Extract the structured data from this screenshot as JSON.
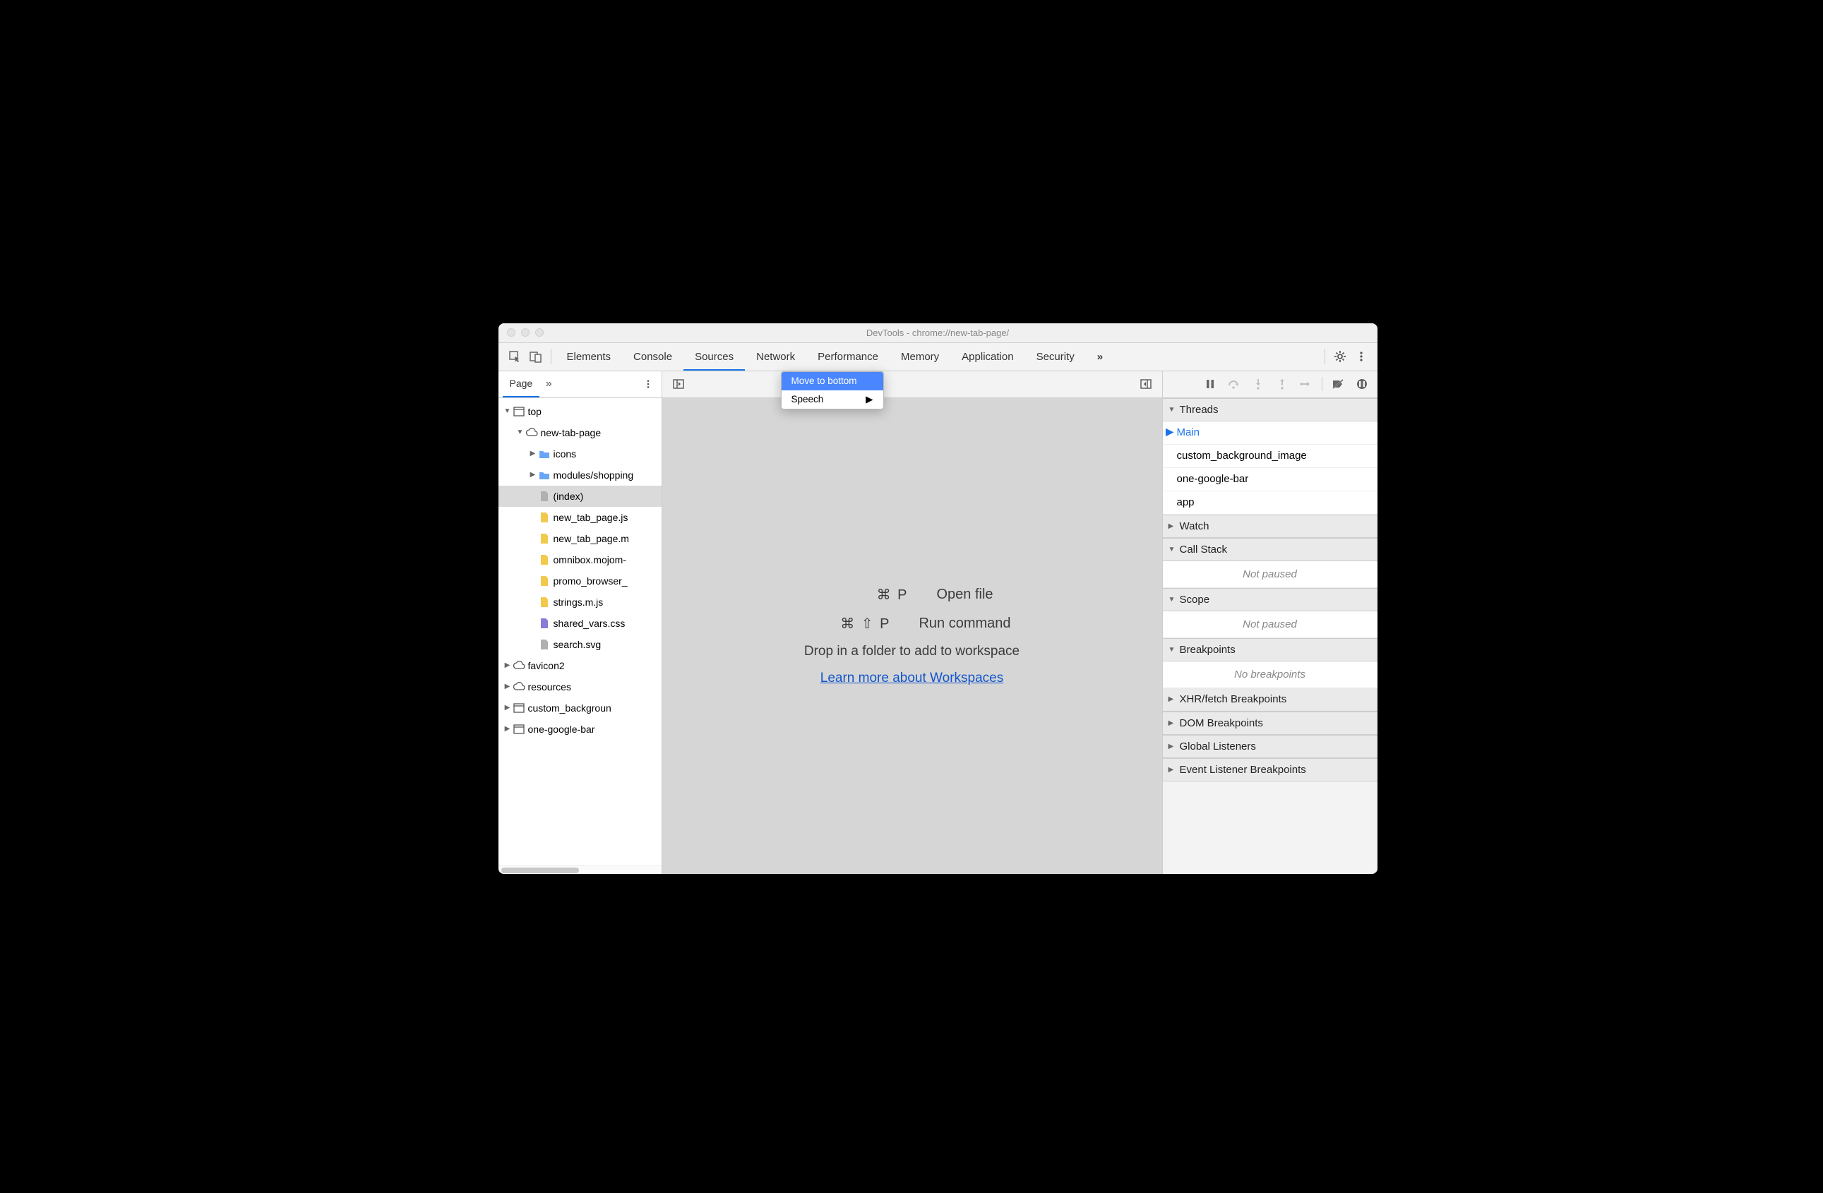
{
  "window": {
    "title": "DevTools - chrome://new-tab-page/"
  },
  "toolbar": {
    "tabs": [
      "Elements",
      "Console",
      "Sources",
      "Network",
      "Performance",
      "Memory",
      "Application",
      "Security"
    ],
    "active_tab": "Sources"
  },
  "context_menu": {
    "items": [
      {
        "label": "Move to bottom",
        "submenu": false,
        "highlight": true
      },
      {
        "label": "Speech",
        "submenu": true,
        "highlight": false
      }
    ]
  },
  "left": {
    "tab": "Page",
    "tree": [
      {
        "depth": 0,
        "twist": "down",
        "icon": "frame",
        "label": "top"
      },
      {
        "depth": 1,
        "twist": "down",
        "icon": "cloud",
        "label": "new-tab-page"
      },
      {
        "depth": 2,
        "twist": "right",
        "icon": "folder",
        "label": "icons"
      },
      {
        "depth": 2,
        "twist": "right",
        "icon": "folder",
        "label": "modules/shopping"
      },
      {
        "depth": 2,
        "twist": "",
        "icon": "page",
        "label": "(index)",
        "selected": true
      },
      {
        "depth": 2,
        "twist": "",
        "icon": "js",
        "label": "new_tab_page.js"
      },
      {
        "depth": 2,
        "twist": "",
        "icon": "js",
        "label": "new_tab_page.m"
      },
      {
        "depth": 2,
        "twist": "",
        "icon": "js",
        "label": "omnibox.mojom-"
      },
      {
        "depth": 2,
        "twist": "",
        "icon": "js",
        "label": "promo_browser_"
      },
      {
        "depth": 2,
        "twist": "",
        "icon": "js",
        "label": "strings.m.js"
      },
      {
        "depth": 2,
        "twist": "",
        "icon": "css",
        "label": "shared_vars.css"
      },
      {
        "depth": 2,
        "twist": "",
        "icon": "page",
        "label": "search.svg"
      },
      {
        "depth": 0,
        "twist": "right",
        "icon": "cloud",
        "label": "favicon2"
      },
      {
        "depth": 0,
        "twist": "right",
        "icon": "cloud",
        "label": "resources"
      },
      {
        "depth": 0,
        "twist": "right",
        "icon": "frame",
        "label": "custom_backgroun"
      },
      {
        "depth": 0,
        "twist": "right",
        "icon": "frame",
        "label": "one-google-bar"
      }
    ]
  },
  "mid": {
    "shortcuts": [
      {
        "keys": "⌘ P",
        "label": "Open file"
      },
      {
        "keys": "⌘ ⇧ P",
        "label": "Run command"
      }
    ],
    "drop_text": "Drop in a folder to add to workspace",
    "link_text": "Learn more about Workspaces"
  },
  "right": {
    "threads": {
      "header": "Threads",
      "items": [
        "Main",
        "custom_background_image",
        "one-google-bar",
        "app"
      ],
      "active": "Main"
    },
    "watch": {
      "header": "Watch"
    },
    "callstack": {
      "header": "Call Stack",
      "empty": "Not paused"
    },
    "scope": {
      "header": "Scope",
      "empty": "Not paused"
    },
    "breakpoints": {
      "header": "Breakpoints",
      "empty": "No breakpoints"
    },
    "sections": [
      "XHR/fetch Breakpoints",
      "DOM Breakpoints",
      "Global Listeners",
      "Event Listener Breakpoints"
    ]
  }
}
